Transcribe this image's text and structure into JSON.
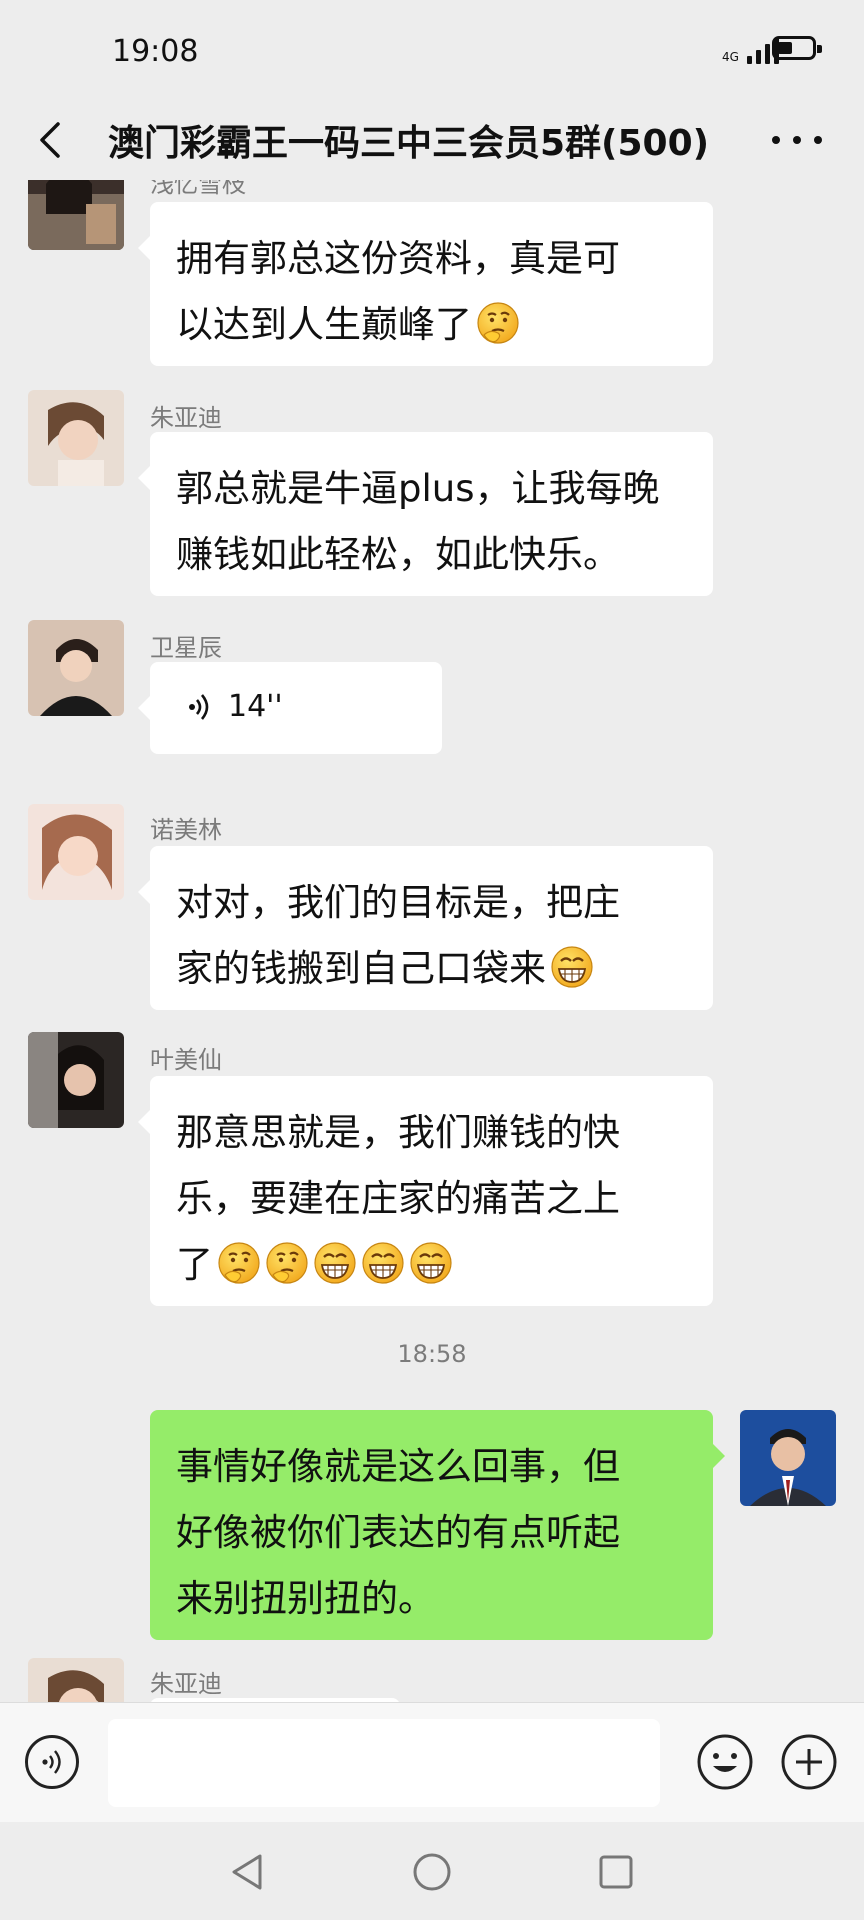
{
  "status_bar": {
    "time": "19:08",
    "network": "4G"
  },
  "header": {
    "title": "澳门彩霸王一码三中三会员5群(500)"
  },
  "messages": [
    {
      "sender": "浅忆雪枝",
      "line1": "拥有郭总这份资料，真是可",
      "line2": "以达到人生巅峰了"
    },
    {
      "sender": "朱亚迪",
      "line1": "郭总就是牛逼plus，让我每晚",
      "line2": "赚钱如此轻松，如此快乐。"
    },
    {
      "sender": "卫星辰",
      "voice_duration": "14''"
    },
    {
      "sender": "诺美林",
      "line1": "对对，我们的目标是，把庄",
      "line2": "家的钱搬到自己口袋来"
    },
    {
      "sender": "叶美仙",
      "line1": "那意思就是，我们赚钱的快",
      "line2": "乐，要建在庄家的痛苦之上",
      "line3": "了"
    },
    {
      "sender": "朱亚迪"
    }
  ],
  "timestamp": "18:58",
  "my_message": {
    "line1": "事情好像就是这么回事，但",
    "line2": "好像被你们表达的有点听起",
    "line3": "来别扭别扭的。"
  },
  "colors": {
    "my_bubble": "#95ec69",
    "other_bubble": "#ffffff",
    "background": "#ededed"
  }
}
